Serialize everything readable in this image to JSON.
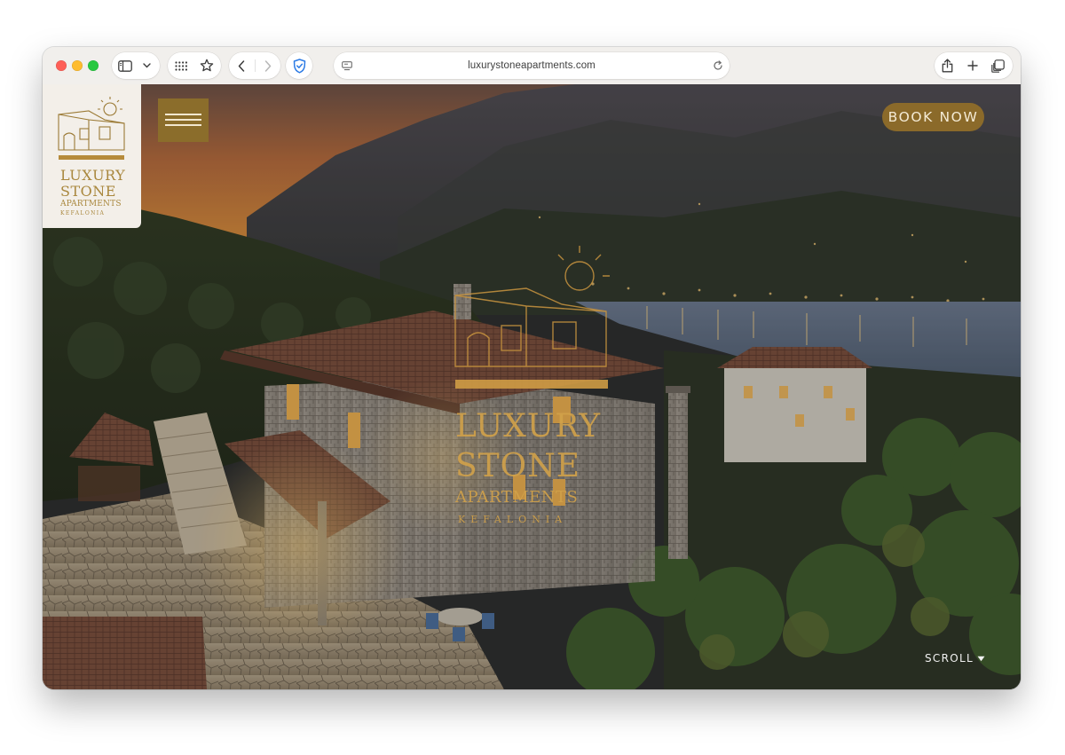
{
  "browser": {
    "url": "luxurystoneapartments.com"
  },
  "site": {
    "logo": {
      "line1": "LUXURY",
      "line2": "STONE",
      "line3": "APARTMENTS",
      "line4": "KEFALONIA"
    },
    "book_now": "BOOK NOW",
    "scroll": "SCROLL",
    "accent_color": "#8b6a2a",
    "gold_color": "#d2a24a"
  },
  "icons": {
    "menu": "hamburger-icon",
    "scroll": "triangle-down-icon"
  }
}
